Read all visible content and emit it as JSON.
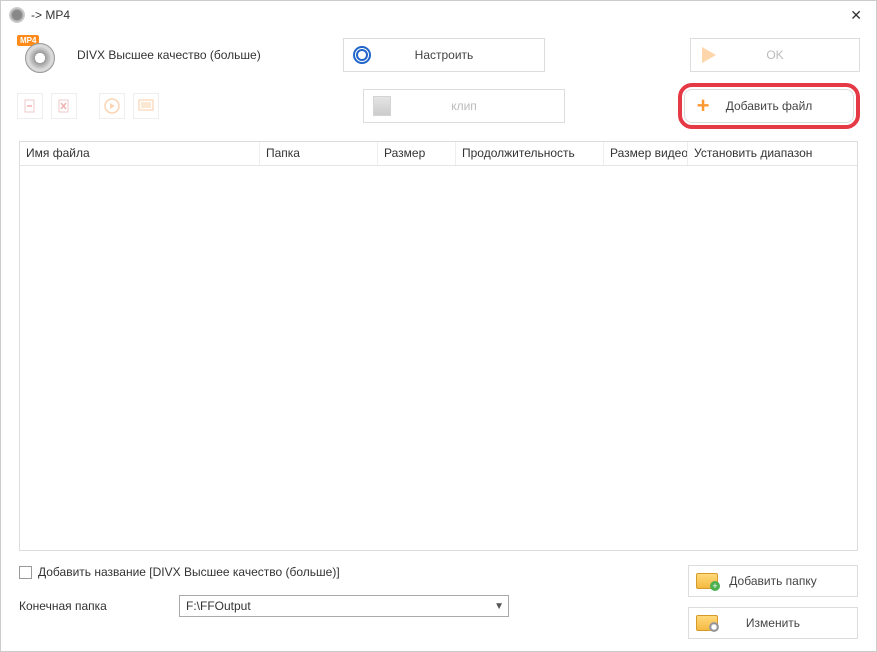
{
  "window": {
    "title": " -> MP4"
  },
  "format": {
    "badge": "MP4",
    "label": "DIVX Высшее качество (больше)"
  },
  "toolbar": {
    "configure": "Настроить",
    "clip": "клип",
    "ok": "OK",
    "add_file": "Добавить файл"
  },
  "columns": {
    "filename": "Имя файла",
    "folder": "Папка",
    "size": "Размер",
    "duration": "Продолжительность",
    "video_size": "Размер видео",
    "set_range": "Установить диапазон"
  },
  "bottom": {
    "add_name_label": "Добавить название [DIVX Высшее качество (больше)]",
    "dest_label": "Конечная папка",
    "dest_value": "F:\\FFOutput",
    "add_folder": "Добавить папку",
    "change": "Изменить"
  }
}
